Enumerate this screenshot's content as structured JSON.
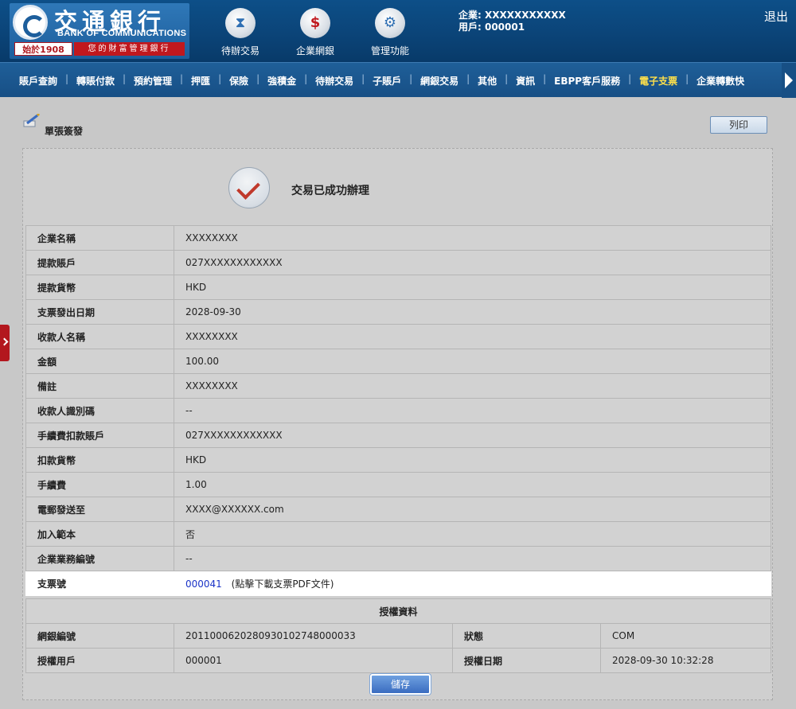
{
  "brand": {
    "cn": "交通銀行",
    "en": "BANK OF COMMUNICATIONS",
    "since": "始於1908",
    "slogan": "您的財富管理銀行"
  },
  "header": {
    "icons": [
      {
        "label": "待辦交易",
        "icon": "hourglass-icon"
      },
      {
        "label": "企業網銀",
        "icon": "dollar-monitor-icon"
      },
      {
        "label": "管理功能",
        "icon": "gears-icon"
      }
    ],
    "company": "企業: XXXXXXXXXXX",
    "user": "用戶: 000001",
    "logout": "退出"
  },
  "nav": {
    "items": [
      "賬戶查詢",
      "轉賬付款",
      "預約管理",
      "押匯",
      "保險",
      "強積金",
      "待辦交易",
      "子賬戶",
      "網銀交易",
      "其他",
      "資訊",
      "EBPP客戶服務",
      "電子支票",
      "企業轉數快"
    ],
    "active_index": 12
  },
  "page": {
    "title": "單張簽發",
    "print_label": "列印",
    "success_message": "交易已成功辦理",
    "save_label": "儲存"
  },
  "details": [
    {
      "label": "企業名稱",
      "value": "XXXXXXXX"
    },
    {
      "label": "提款賬戶",
      "value": "027XXXXXXXXXXXX"
    },
    {
      "label": "提款貨幣",
      "value": "HKD"
    },
    {
      "label": "支票發出日期",
      "value": "2028-09-30"
    },
    {
      "label": "收款人名稱",
      "value": "XXXXXXXX"
    },
    {
      "label": "金額",
      "value": "100.00"
    },
    {
      "label": "備註",
      "value": "XXXXXXXX"
    },
    {
      "label": "收款人識別碼",
      "value": "--"
    },
    {
      "label": "手續費扣款賬戶",
      "value": "027XXXXXXXXXXXX"
    },
    {
      "label": "扣款貨幣",
      "value": "HKD"
    },
    {
      "label": "手續費",
      "value": "1.00"
    },
    {
      "label": "電郵發送至",
      "value": "XXXX@XXXXXX.com"
    },
    {
      "label": "加入範本",
      "value": "否"
    },
    {
      "label": "企業業務編號",
      "value": "--"
    }
  ],
  "cheque": {
    "label": "支票號",
    "number": "000041",
    "note": "(點擊下載支票PDF文件)"
  },
  "auth": {
    "header": "授權資料",
    "ref_label": "網銀編號",
    "ref_value": "2011000620280930102748000033",
    "status_label": "狀態",
    "status_value": "COM",
    "user_label": "授權用戶",
    "user_value": "000001",
    "date_label": "授權日期",
    "date_value": "2028-09-30 10:32:28"
  },
  "colors": {
    "header_bg": "#0b4478",
    "nav_bg": "#1b5790",
    "active_nav": "#ffe04a",
    "link": "#1a33c7",
    "check": "#c0392b"
  }
}
